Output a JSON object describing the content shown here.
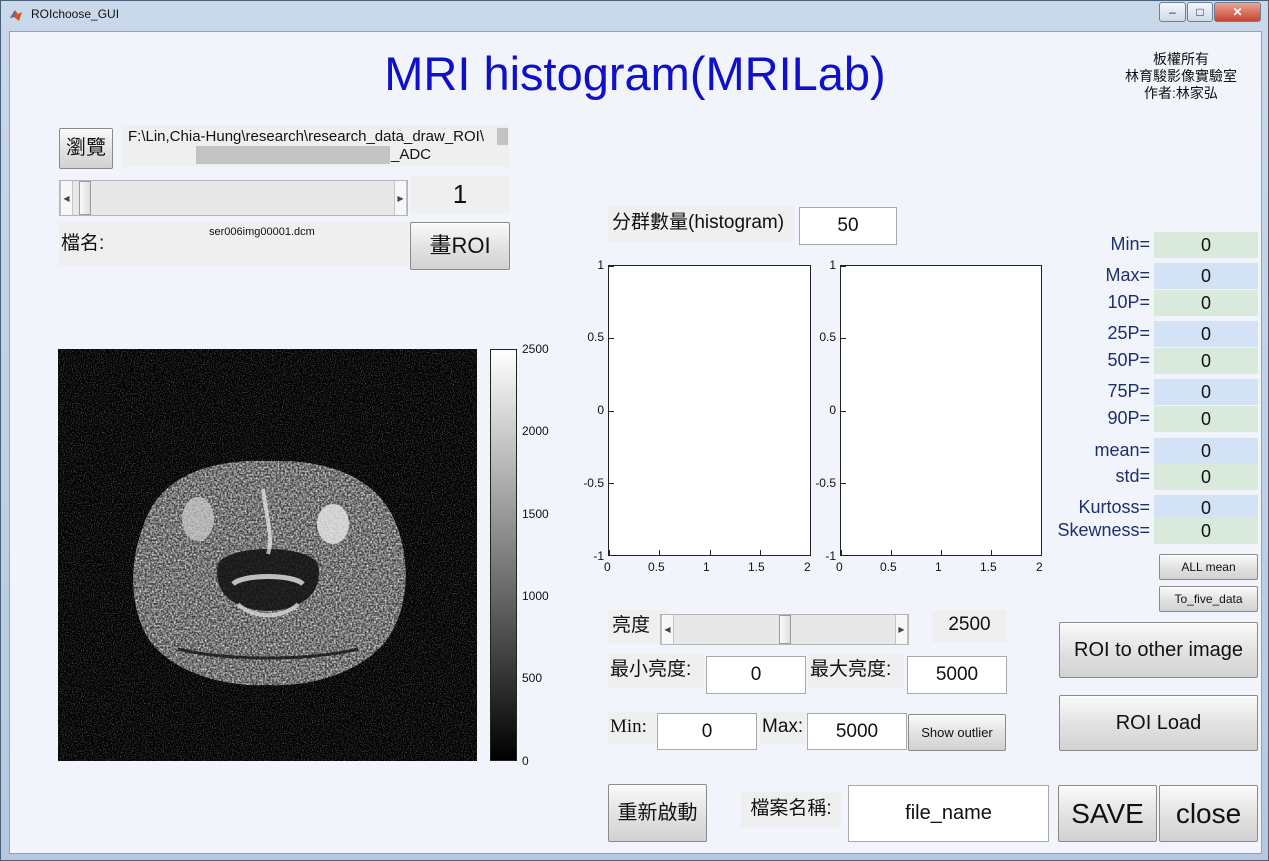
{
  "window": {
    "title": "ROIchoose_GUI",
    "min_glyph": "–",
    "max_glyph": "□",
    "close_glyph": "✕"
  },
  "header": {
    "title": "MRI histogram(MRILab)",
    "copyright_lines": [
      "板權所有",
      "林育駿影像實驗室",
      "作者:林家弘"
    ]
  },
  "browse": {
    "button_label": "瀏覽",
    "path_line1": "F:\\Lin,Chia-Hung\\research\\research_data_draw_ROI\\",
    "path_line2": "_ADC"
  },
  "slice": {
    "slider_value": 0.02,
    "number": "1"
  },
  "file": {
    "label": "檔名:",
    "name": "ser006img00001.dcm",
    "draw_roi_label": "畫ROI"
  },
  "colorbar": {
    "ticks": [
      "2500",
      "2000",
      "1500",
      "1000",
      "500",
      "0"
    ]
  },
  "histogram": {
    "bins_label": "分群數量(histogram)",
    "bins_value": "50",
    "y_ticks": [
      "1",
      "0.5",
      "0",
      "-0.5",
      "-1"
    ],
    "x_ticks": [
      "0",
      "0.5",
      "1",
      "1.5",
      "2"
    ]
  },
  "brightness": {
    "label": "亮度",
    "slider_value": 0.5,
    "value": "2500",
    "min_label": "最小亮度:",
    "min_value": "0",
    "max_label": "最大亮度:",
    "max_value": "5000"
  },
  "range": {
    "min_label": "Min:",
    "min_value": "0",
    "max_label": "Max:",
    "max_value": "5000",
    "outlier_label": "Show outlier"
  },
  "stats": [
    {
      "label": "Min=",
      "value": "0",
      "color": "#d9eadc"
    },
    {
      "label": "Max=",
      "value": "0",
      "color": "#d3e2f5"
    },
    {
      "label": "10P=",
      "value": "0",
      "color": "#d9eadc"
    },
    {
      "label": "25P=",
      "value": "0",
      "color": "#d3e2f5"
    },
    {
      "label": "50P=",
      "value": "0",
      "color": "#d9eadc"
    },
    {
      "label": "75P=",
      "value": "0",
      "color": "#d3e2f5"
    },
    {
      "label": "90P=",
      "value": "0",
      "color": "#d9eadc"
    },
    {
      "label": "mean=",
      "value": "0",
      "color": "#d3e2f5"
    },
    {
      "label": "std=",
      "value": "0",
      "color": "#d9eadc"
    },
    {
      "label": "Kurtoss=",
      "value": "0",
      "color": "#d3e2f5"
    },
    {
      "label": "Skewness=",
      "value": "0",
      "color": "#d9eadc"
    }
  ],
  "buttons": {
    "all_mean": "ALL mean",
    "to_five_data": "To_five_data",
    "roi_to_other": "ROI to other image",
    "roi_load": "ROI Load",
    "restart": "重新啟動",
    "save": "SAVE",
    "close": "close"
  },
  "filename": {
    "label": "檔案名稱:",
    "value": "file_name"
  },
  "colors": {
    "title": "#1010c8",
    "stat_label": "#1f2f6e"
  }
}
